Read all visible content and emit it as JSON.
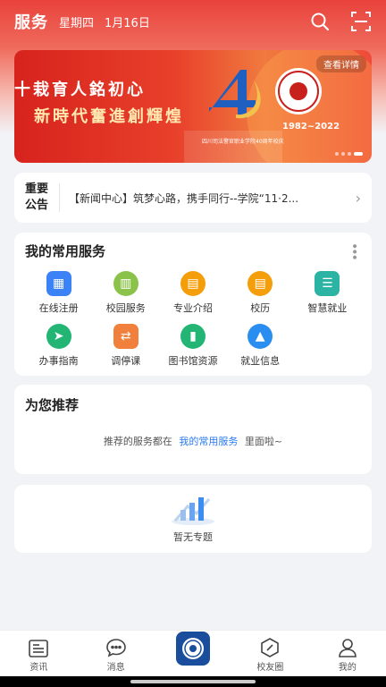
{
  "header": {
    "title": "服务",
    "weekday": "星期四",
    "date": "1月16日",
    "search_icon": "search-icon",
    "scan_icon": "scan-icon"
  },
  "banner": {
    "slogan_line1": "十栽育人銘初心",
    "slogan_line2": "新時代奮進創輝煌",
    "detail_label": "查看详情",
    "years": "1982~2022",
    "subtitle": "四川司法警官职业学院40周年校庆"
  },
  "notice": {
    "tag_line1": "重要",
    "tag_line2": "公告",
    "text": "【新闻中心】筑梦心路，携手同行--学院“11·2...",
    "arrow_icon": "chevron-right-icon"
  },
  "services": {
    "title": "我的常用服务",
    "items": [
      {
        "label": "在线注册",
        "icon": "calendar-icon",
        "color": "#3b82f6"
      },
      {
        "label": "校园服务",
        "icon": "building-icon",
        "color": "#8bc34a"
      },
      {
        "label": "专业介绍",
        "icon": "book-icon",
        "color": "#f59e0b"
      },
      {
        "label": "校历",
        "icon": "book-open-icon",
        "color": "#f59e0b"
      },
      {
        "label": "智慧就业",
        "icon": "checklist-icon",
        "color": "#2bb3a3"
      },
      {
        "label": "办事指南",
        "icon": "signpost-icon",
        "color": "#22b573"
      },
      {
        "label": "调停课",
        "icon": "swap-icon",
        "color": "#f0803c"
      },
      {
        "label": "图书馆资源",
        "icon": "chart-icon",
        "color": "#22b573"
      },
      {
        "label": "就业信息",
        "icon": "graduation-cap-icon",
        "color": "#2a8ef0"
      }
    ]
  },
  "recommend": {
    "title": "为您推荐",
    "tip_before": "推荐的服务都在",
    "tip_link": "我的常用服务",
    "tip_after": "里面啦~"
  },
  "topics": {
    "empty_label": "暂无专题"
  },
  "tabbar": {
    "items": [
      {
        "label": "资讯",
        "icon": "news-icon"
      },
      {
        "label": "消息",
        "icon": "message-icon"
      },
      {
        "label": "",
        "icon": "school-logo-icon"
      },
      {
        "label": "校友圈",
        "icon": "compass-icon"
      },
      {
        "label": "我的",
        "icon": "user-icon"
      }
    ]
  }
}
